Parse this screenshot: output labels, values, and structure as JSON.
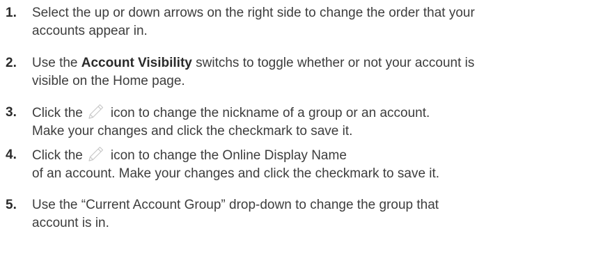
{
  "steps": [
    {
      "number": "1.",
      "line1": "Select the up or down arrows on the right side to change the order that your",
      "line2": "accounts appear in."
    },
    {
      "number": "2.",
      "pre": "Use the ",
      "bold": "Account Visibility",
      "post": " switchs to toggle whether or not your account is",
      "line2": "visible on the Home page."
    },
    {
      "number": "3.",
      "pre": "Click the",
      "icon": "pencil-icon",
      "post": "icon to change the nickname of a group or an account.",
      "line2": "Make your changes and click the checkmark to save it."
    },
    {
      "number": "4.",
      "pre": "Click the",
      "icon": "pencil-icon",
      "post": "icon  to change the Online Display Name",
      "line2": "of an account. Make your changes and click the checkmark to save it."
    },
    {
      "number": "5.",
      "line1": "Use the “Current Account Group” drop-down to change the group that",
      "line2": "account is in."
    }
  ],
  "colors": {
    "text": "#3d3d3d",
    "number": "#2b2b2b",
    "icon_stroke": "#c8c8c8"
  }
}
